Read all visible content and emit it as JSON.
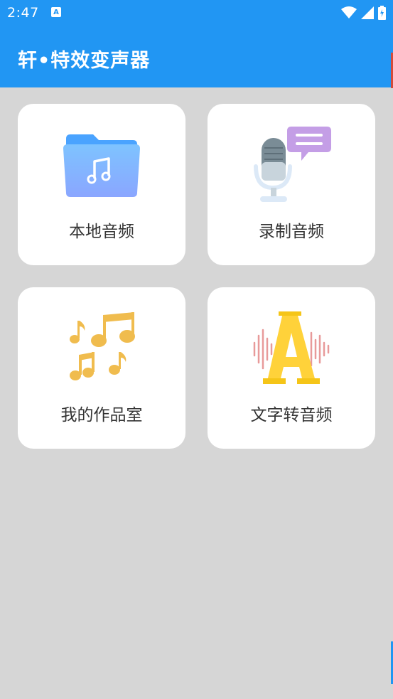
{
  "status_bar": {
    "time": "2:47",
    "notification_glyph": "A",
    "icons": [
      "wifi-icon",
      "cell-signal-icon",
      "battery-charging-icon"
    ]
  },
  "app_bar": {
    "title": "轩•特效变声器",
    "color": "#2196f3"
  },
  "cards": [
    {
      "label": "本地音频",
      "icon": "music-folder-icon"
    },
    {
      "label": "录制音频",
      "icon": "microphone-chat-icon"
    },
    {
      "label": "我的作品室",
      "icon": "music-notes-icon"
    },
    {
      "label": "文字转音频",
      "icon": "text-sound-wave-icon"
    }
  ]
}
